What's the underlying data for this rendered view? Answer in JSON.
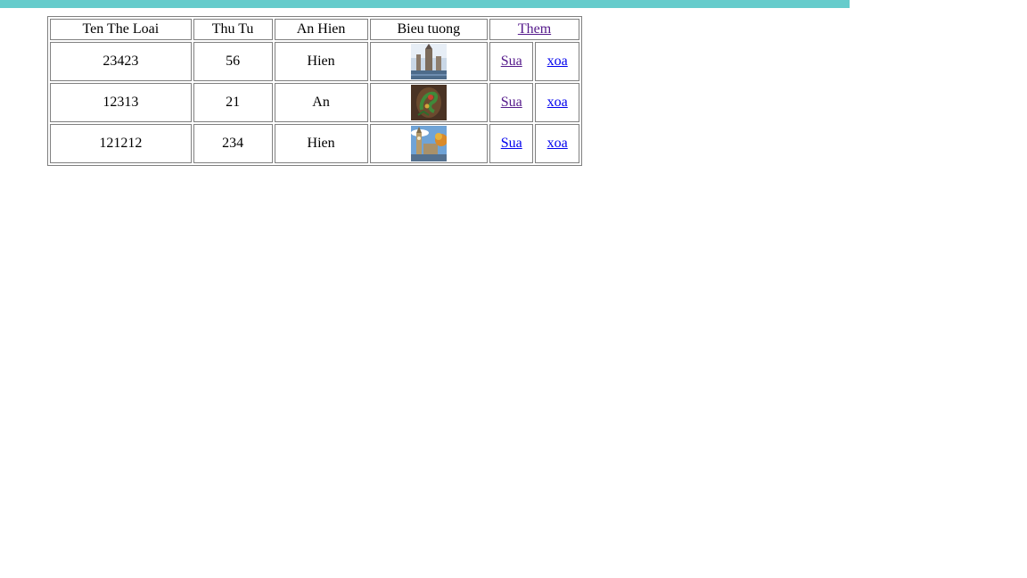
{
  "table": {
    "headers": {
      "name": "Ten The Loai",
      "order": "Thu Tu",
      "visibility": "An Hien",
      "icon": "Bieu tuong",
      "add_link": "Them"
    },
    "rows": [
      {
        "name": "23423",
        "order": "56",
        "visibility": "Hien",
        "icon": "city-landmark-icon",
        "edit": "Sua",
        "delete": "xoa"
      },
      {
        "name": "12313",
        "order": "21",
        "visibility": "An",
        "icon": "dragon-art-icon",
        "edit": "Sua",
        "delete": "xoa"
      },
      {
        "name": "121212",
        "order": "234",
        "visibility": "Hien",
        "icon": "clock-tower-icon",
        "edit": "Sua",
        "delete": "xoa"
      }
    ]
  },
  "colors": {
    "top_bar": "#66cccc",
    "link": "#0000ee",
    "visited_link": "#551a8b"
  }
}
